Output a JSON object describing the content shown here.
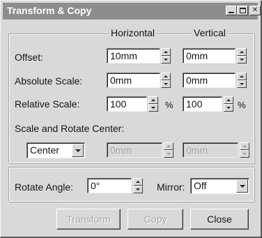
{
  "window": {
    "title": "Transform & Copy",
    "title_bar_color": "#8d8d8d"
  },
  "headers": {
    "horizontal": "Horizontal",
    "vertical": "Vertical"
  },
  "rows": {
    "offset": {
      "label": "Offset:",
      "horizontal": "10mm",
      "vertical": "0mm"
    },
    "absolute_scale": {
      "label": "Absolute Scale:",
      "horizontal": "0mm",
      "vertical": "0mm"
    },
    "relative_scale": {
      "label": "Relative Scale:",
      "horizontal": "100",
      "vertical": "100",
      "unit": "%"
    }
  },
  "center": {
    "label": "Scale and Rotate Center:",
    "selected": "Center",
    "horizontal": "0mm",
    "vertical": "0mm"
  },
  "rotate": {
    "label": "Rotate Angle:",
    "value": "0°"
  },
  "mirror": {
    "label": "Mirror:",
    "selected": "Off"
  },
  "buttons": {
    "transform": "Transform",
    "copy": "Copy",
    "close": "Close"
  }
}
